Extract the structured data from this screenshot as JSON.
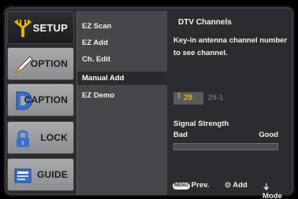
{
  "tabs": [
    {
      "label": "SETUP",
      "icon": "antenna-icon",
      "active": true
    },
    {
      "label": "OPTION",
      "icon": "pencil-icon",
      "active": false
    },
    {
      "label": "CAPTION",
      "icon": "caption-d-icon",
      "active": false
    },
    {
      "label": "LOCK",
      "icon": "padlock-icon",
      "active": false
    },
    {
      "label": "GUIDE",
      "icon": "guide-book-icon",
      "active": false
    }
  ],
  "menu": {
    "items": [
      "EZ Scan",
      "EZ Add",
      "Ch. Edit",
      "Manual Add",
      "EZ Demo"
    ],
    "selected": "Manual Add"
  },
  "panel": {
    "title": "DTV Channels",
    "instructions": "Key-in antenna channel number to see channel.",
    "channel_number": "29",
    "sub_channel": "29-1",
    "signal_label": "Signal Strength",
    "bad_label": "Bad",
    "good_label": "Good",
    "signal_level": 0
  },
  "hints": {
    "menu_key": "MENU",
    "prev": "Prev.",
    "add_symbol": "⊙",
    "add": "Add",
    "mode_symbol": "⏚",
    "mode": "Mode"
  },
  "colors": {
    "accent": "#e8b000",
    "disabled_text": "#6f6f73",
    "panel_bg": "#2c2c30",
    "menu_bg": "#47474b"
  }
}
